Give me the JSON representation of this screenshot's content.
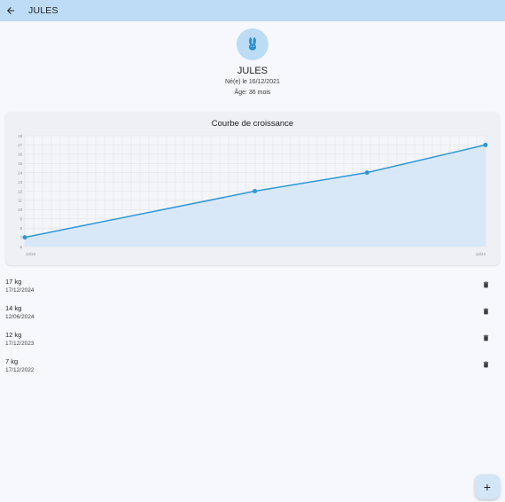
{
  "app_bar": {
    "title": "JULES",
    "back_icon": "arrow-back-icon"
  },
  "profile": {
    "avatar_icon": "bunny-icon",
    "name": "JULES",
    "birth": "Né(e) le 16/12/2021",
    "age": "Âge: 36 mois"
  },
  "colors": {
    "app_bar": "#bedcf6",
    "accent": "#2f97d4",
    "area_fill": "#d6e7f8",
    "background": "#f7f8fd"
  },
  "chart_data": {
    "type": "line",
    "title": "Courbe de croissance",
    "x": [
      "17/12/2022",
      "17/12/2023",
      "12/06/2024",
      "17/12/2024"
    ],
    "x_days": [
      0,
      365,
      543,
      731
    ],
    "series": [
      {
        "values": [
          7,
          12,
          14,
          17
        ]
      }
    ],
    "ylim": [
      6,
      18
    ],
    "y_ticks": [
      "6",
      "7",
      "8",
      "9",
      "10",
      "11",
      "12",
      "13",
      "14",
      "15",
      "16",
      "17",
      "18"
    ],
    "x_tick_labels": [
      "12/22",
      "12/24"
    ],
    "grid": true,
    "area_fill": true
  },
  "weights": [
    {
      "weight": "17 kg",
      "date": "17/12/2024"
    },
    {
      "weight": "14 kg",
      "date": "12/06/2024"
    },
    {
      "weight": "12 kg",
      "date": "17/12/2023"
    },
    {
      "weight": "7 kg",
      "date": "17/12/2022"
    }
  ],
  "delete_icon": "trash-icon",
  "fab": {
    "label": "+",
    "icon": "plus-icon"
  }
}
